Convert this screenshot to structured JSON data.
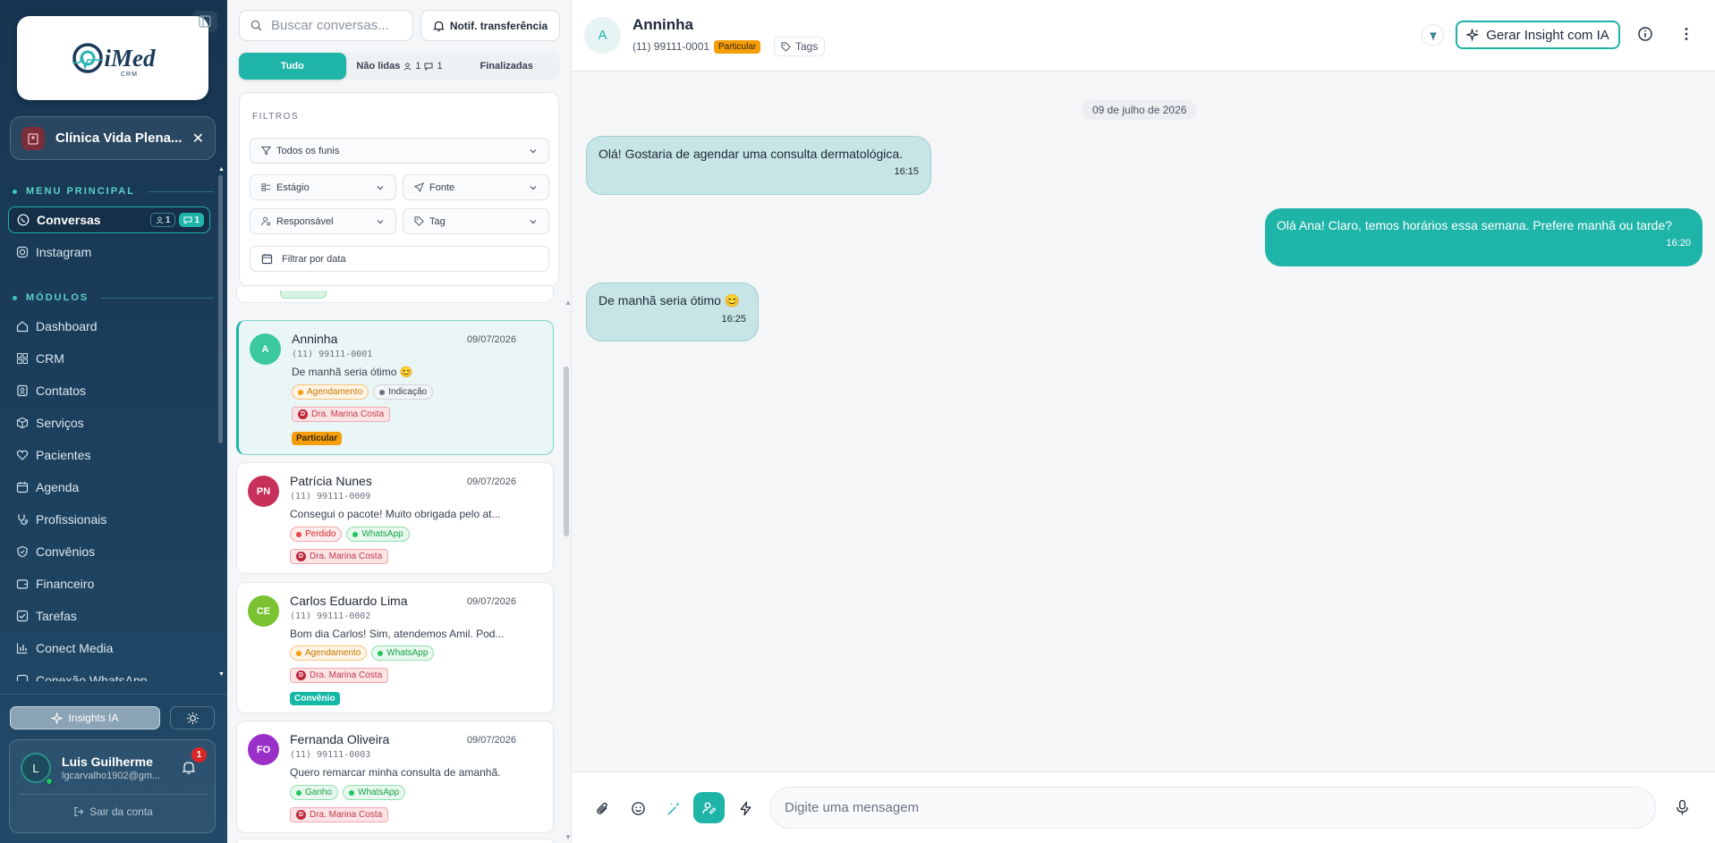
{
  "sidebar": {
    "logo_text": "iMed",
    "logo_sub": "CRM",
    "clinic_name": "Clínica Vida Plena...",
    "section_main": "MENU PRINCIPAL",
    "section_modules": "MÓDULOS",
    "main_items": [
      {
        "label": "Conversas",
        "badge_unread": "1",
        "badge_chat": "1",
        "icon": "whatsapp-icon"
      },
      {
        "label": "Instagram",
        "icon": "instagram-icon"
      }
    ],
    "module_items": [
      {
        "label": "Dashboard",
        "icon": "home-icon"
      },
      {
        "label": "CRM",
        "icon": "grid-icon"
      },
      {
        "label": "Contatos",
        "icon": "contacts-icon"
      },
      {
        "label": "Serviços",
        "icon": "box-icon"
      },
      {
        "label": "Pacientes",
        "icon": "heart-icon"
      },
      {
        "label": "Agenda",
        "icon": "calendar-icon"
      },
      {
        "label": "Profissionais",
        "icon": "stethoscope-icon"
      },
      {
        "label": "Convênios",
        "icon": "shield-icon"
      },
      {
        "label": "Financeiro",
        "icon": "wallet-icon"
      },
      {
        "label": "Tarefas",
        "icon": "checkbox-icon"
      },
      {
        "label": "Conect Media",
        "icon": "bar-chart-icon"
      },
      {
        "label": "Conexão WhatsApp",
        "icon": "link-icon"
      }
    ],
    "insights_label": "Insights IA",
    "user": {
      "initial": "L",
      "name": "Luis Guilherme",
      "email": "lgcarvalho1902@gm...",
      "notifications": "1",
      "logout_label": "Sair da conta"
    }
  },
  "list": {
    "search_placeholder": "Buscar conversas...",
    "notif_label": "Notif. transferência",
    "tabs": [
      {
        "label": "Tudo"
      },
      {
        "label": "Não lidas",
        "count_person": "1",
        "count_chat": "1"
      },
      {
        "label": "Finalizadas"
      }
    ],
    "filters": {
      "title": "FILTROS",
      "funnel": "Todos os funis",
      "stage": "Estágio",
      "source": "Fonte",
      "owner": "Responsável",
      "tag": "Tag",
      "date": "Filtrar por data"
    },
    "conversations": [
      {
        "initials": "A",
        "name": "Anninha",
        "date": "09/07/2026",
        "phone": "(11) 99111-0001",
        "message": "De manhã seria ótimo 😊",
        "tags": [
          "Agendamento",
          "Indicação"
        ],
        "doctor": "Dra. Marina Costa",
        "pill": "Particular"
      },
      {
        "initials": "PN",
        "name": "Patrícia Nunes",
        "date": "09/07/2026",
        "phone": "(11) 99111-0009",
        "message": "Consegui o pacote! Muito obrigada pelo at...",
        "tags": [
          "Perdido",
          "WhatsApp"
        ],
        "doctor": "Dra. Marina Costa",
        "pill": ""
      },
      {
        "initials": "CE",
        "name": "Carlos Eduardo Lima",
        "date": "09/07/2026",
        "phone": "(11) 99111-0002",
        "message": "Bom dia Carlos! Sim, atendemos Amil. Pod...",
        "tags": [
          "Agendamento",
          "WhatsApp"
        ],
        "doctor": "Dra. Marina Costa",
        "pill": "Convênio"
      },
      {
        "initials": "FO",
        "name": "Fernanda Oliveira",
        "date": "09/07/2026",
        "phone": "(11) 99111-0003",
        "message": "Quero remarcar minha consulta de amanhã.",
        "tags": [
          "Ganho",
          "WhatsApp"
        ],
        "doctor": "Dra. Marina Costa",
        "pill": ""
      }
    ]
  },
  "chat": {
    "contact_initial": "A",
    "contact_name": "Anninha",
    "contact_phone": "(11) 99111-0001",
    "contact_pill": "Particular",
    "tags_label": "Tags",
    "insight_button": "Gerar Insight com IA",
    "date_divider": "09 de julho de 2026",
    "messages": [
      {
        "direction": "in",
        "text": "Olá! Gostaria de agendar uma consulta dermatológica.",
        "time": "16:15"
      },
      {
        "direction": "out",
        "text": "Olá Ana! Claro, temos horários essa semana. Prefere manhã ou tarde?",
        "time": "16:20"
      },
      {
        "direction": "in",
        "text": "De manhã seria ótimo 😊",
        "time": "16:25"
      }
    ],
    "composer_placeholder": "Digite uma mensagem"
  },
  "colors": {
    "accent": "#1fb4a8",
    "sidebar_bg": "#1b3e5c",
    "pill_particular": "#f59e0b",
    "pill_convenio": "#14b8a6"
  }
}
